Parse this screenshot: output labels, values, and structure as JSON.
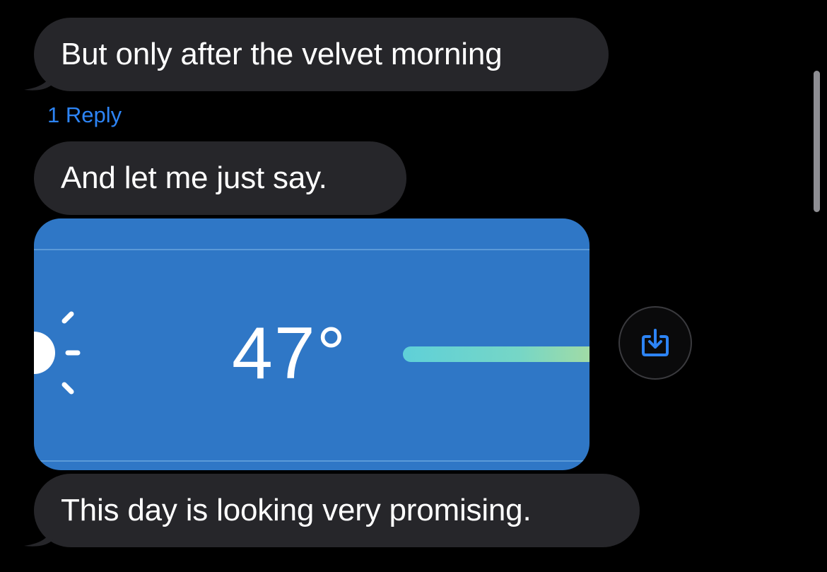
{
  "messages": [
    {
      "text": "But only after the velvet morning"
    },
    {
      "text": "And let me just say."
    },
    {
      "text": "This day is looking very promising."
    }
  ],
  "reply_link": "1 Reply",
  "weather_image": {
    "temperature": "47°",
    "icon": "sun-icon"
  },
  "save_button": {
    "icon": "save-download-icon"
  },
  "colors": {
    "background": "#000000",
    "bubble": "#26262a",
    "accent": "#2d84f5",
    "weather_bg": "#2f77c6"
  }
}
